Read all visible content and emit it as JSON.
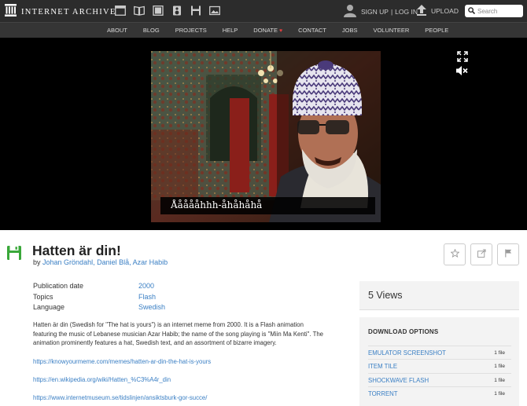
{
  "header": {
    "logo_text": "INTERNET ARCHIVE",
    "media_icons": [
      "web-icon",
      "texts-icon",
      "video-icon",
      "audio-icon",
      "software-icon",
      "images-icon"
    ],
    "sign_up": "SIGN UP",
    "separator": "|",
    "log_in": "LOG IN",
    "upload": "UPLOAD",
    "search_placeholder": "Search"
  },
  "nav": {
    "items": [
      "ABOUT",
      "BLOG",
      "PROJECTS",
      "HELP",
      "DONATE",
      "CONTACT",
      "JOBS",
      "VOLUNTEER",
      "PEOPLE"
    ],
    "heart": "♥"
  },
  "player": {
    "caption": "Åååååhhh-åhåhåhå"
  },
  "item": {
    "title": "Hatten är din!",
    "by_prefix": "by",
    "authors": "Johan Gröndahl, Daniel Blå, Azar Habib",
    "metadata": [
      {
        "key": "Publication date",
        "value": "2000"
      },
      {
        "key": "Topics",
        "value": "Flash"
      },
      {
        "key": "Language",
        "value": "Swedish"
      }
    ],
    "description": "Hatten är din (Swedish for \"The hat is yours\") is an internet meme from 2000. It is a Flash animation featuring the music of Lebanese musician Azar Habib; the name of the song playing is \"Miin Ma Kenti\". The animation prominently features a hat, Swedish text, and an assortment of bizarre imagery.",
    "links": [
      "https://knowyourmeme.com/memes/hatten-ar-din-the-hat-is-yours",
      "https://en.wikipedia.org/wiki/Hatten_%C3%A4r_din",
      "https://www.internetmuseum.se/tidslinjen/ansiktsburk-gor-succe/"
    ]
  },
  "sidebar": {
    "views": "5 Views",
    "download_title": "DOWNLOAD OPTIONS",
    "downloads": [
      {
        "name": "EMULATOR SCREENSHOT",
        "count": "1 file"
      },
      {
        "name": "ITEM TILE",
        "count": "1 file"
      },
      {
        "name": "SHOCKWAVE FLASH",
        "count": "1 file"
      },
      {
        "name": "TORRENT",
        "count": "1 file"
      }
    ]
  },
  "colors": {
    "topbar": "#2c2c2c",
    "navbar": "#353535",
    "link": "#3a7fc4",
    "item_icon": "#3aa83a",
    "donate_heart": "#e04040"
  }
}
